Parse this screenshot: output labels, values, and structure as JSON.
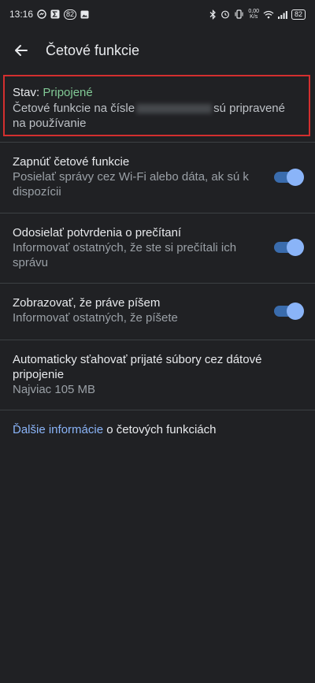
{
  "status_bar": {
    "time": "13:16",
    "notif_badge": "82",
    "net_speed_value": "0,00",
    "net_speed_unit": "K/s",
    "battery": "82"
  },
  "app_bar": {
    "title": "Četové funkcie"
  },
  "status_card": {
    "label": "Stav: ",
    "value": "Pripojené",
    "desc_before": "Četové funkcie na čísle",
    "desc_after": "sú pripravené na používanie"
  },
  "settings": [
    {
      "title": "Zapnúť četové funkcie",
      "subtitle": "Posielať správy cez Wi-Fi alebo dáta, ak sú k dispozícii",
      "enabled": true
    },
    {
      "title": "Odosielať potvrdenia o prečítaní",
      "subtitle": "Informovať ostatných, že ste si prečítali ich správu",
      "enabled": true
    },
    {
      "title": "Zobrazovať, že práve píšem",
      "subtitle": "Informovať ostatných, že píšete",
      "enabled": true
    },
    {
      "title": "Automaticky sťahovať prijaté súbory cez dátové pripojenie",
      "subtitle": "Najviac 105 MB"
    }
  ],
  "footer": {
    "link": "Ďalšie informácie",
    "rest": " o četových funkciách"
  },
  "colors": {
    "background": "#202124",
    "accent": "#8ab4f8",
    "connected": "#81c995",
    "highlight_border": "#d32f2f"
  }
}
